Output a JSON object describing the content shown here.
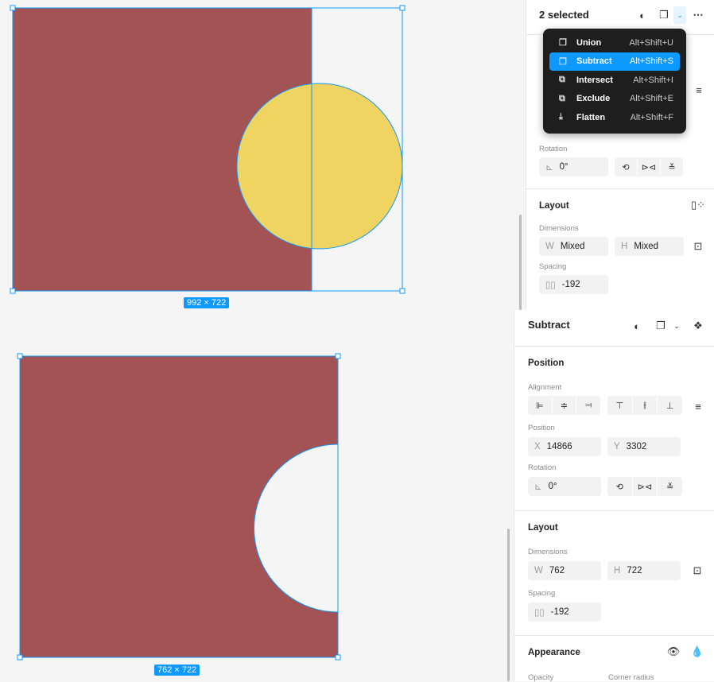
{
  "top": {
    "title": "2 selected",
    "menu": [
      {
        "label": "Union",
        "shortcut": "Alt+Shift+U",
        "icon": "union-icon"
      },
      {
        "label": "Subtract",
        "shortcut": "Alt+Shift+S",
        "icon": "subtract-icon",
        "selected": true
      },
      {
        "label": "Intersect",
        "shortcut": "Alt+Shift+I",
        "icon": "intersect-icon"
      },
      {
        "label": "Exclude",
        "shortcut": "Alt+Shift+E",
        "icon": "exclude-icon"
      },
      {
        "label": "Flatten",
        "shortcut": "Alt+Shift+F",
        "icon": "flatten-icon"
      }
    ],
    "rotation_label": "Rotation",
    "rotation": "0°",
    "layout": "Layout",
    "dimensions": "Dimensions",
    "w_prefix": "W",
    "w": "Mixed",
    "h_prefix": "H",
    "h": "Mixed",
    "spacing": "Spacing",
    "spacing_value": "-192",
    "size_label": "992 × 722"
  },
  "bottom": {
    "title": "Subtract",
    "position": "Position",
    "alignment": "Alignment",
    "position_label": "Position",
    "x_prefix": "X",
    "x": "14866",
    "y_prefix": "Y",
    "y": "3302",
    "rotation_label": "Rotation",
    "rotation": "0°",
    "layout": "Layout",
    "dimensions": "Dimensions",
    "w_prefix": "W",
    "w": "762",
    "h_prefix": "H",
    "h": "722",
    "spacing": "Spacing",
    "spacing_value": "-192",
    "appearance": "Appearance",
    "opacity": "Opacity",
    "corner_radius": "Corner radius",
    "size_label": "762 × 722"
  },
  "colors": {
    "rect": "#a35353",
    "circle": "#f0d462",
    "selection": "#0d99ff"
  }
}
